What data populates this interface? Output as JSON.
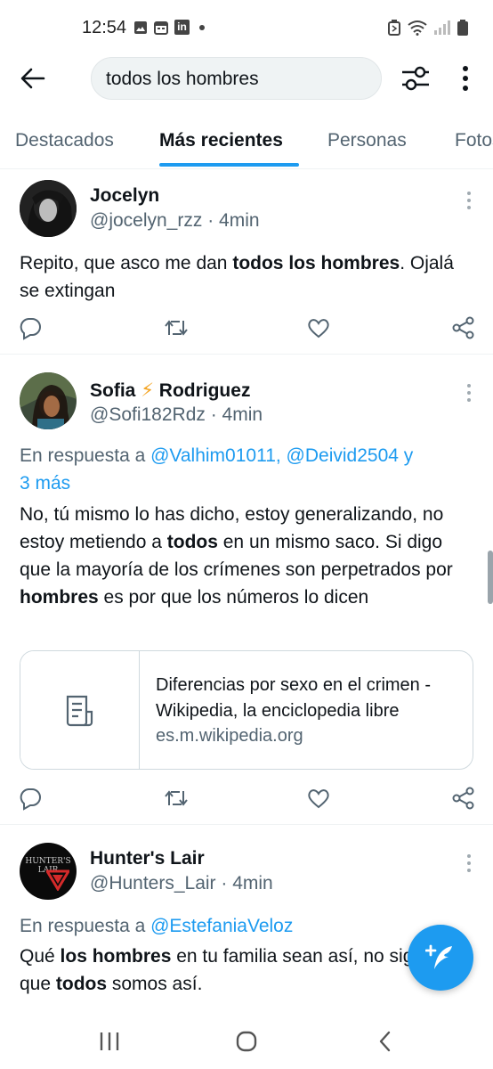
{
  "status_bar": {
    "time": "12:54",
    "left_icons": [
      "image-icon",
      "calendar-icon",
      "linkedin-icon",
      "dot-icon"
    ],
    "right_icons": [
      "battery-saver-icon",
      "wifi-icon",
      "signal-icon",
      "battery-icon"
    ],
    "linkedin_label": "in"
  },
  "topbar": {
    "search_query": "todos los hombres"
  },
  "tabs": [
    {
      "label": "Destacados",
      "active": false
    },
    {
      "label": "Más recientes",
      "active": true
    },
    {
      "label": "Personas",
      "active": false
    },
    {
      "label": "Fotos",
      "active": false
    }
  ],
  "tweets": [
    {
      "name": "Jocelyn",
      "name_suffix": "",
      "handle_time": "@jocelyn_rzz · 4min",
      "reply_prefix": "",
      "reply_mentions": "",
      "reply_tail": "",
      "reply_more": "",
      "body": [
        {
          "text": "Repito, que asco me dan "
        },
        {
          "text": "todos los hombres",
          "bold": true
        },
        {
          "text": ". Ojalá se extingan"
        }
      ]
    },
    {
      "name": "Sofia",
      "name_emoji": "⚡",
      "name_suffix": "Rodriguez",
      "handle_time": "@Sofi182Rdz · 4min",
      "reply_prefix": "En respuesta a ",
      "reply_mentions": "@Valhim01011, @Deivid2504",
      "reply_tail": " y",
      "reply_more": "3 más",
      "body": [
        {
          "text": "No, tú mismo lo has dicho, estoy generalizando, no estoy metiendo a "
        },
        {
          "text": "todos",
          "bold": true
        },
        {
          "text": " en un mismo saco. Si digo que la mayoría de los crímenes son perpetrados por "
        },
        {
          "text": "hombres",
          "bold": true
        },
        {
          "text": " es por que los números lo dicen"
        }
      ],
      "link_card": {
        "title": "Diferencias por sexo en el crimen - Wikipedia, la enciclopedia libre",
        "domain": "es.m.wikipedia.org"
      }
    },
    {
      "name": "Hunter's Lair",
      "handle_time": "@Hunters_Lair · 4min",
      "avatar_text_top": "HUNTER'S",
      "avatar_text_bottom": "LAIR",
      "reply_prefix": "En respuesta a ",
      "reply_mentions": "@EstefaniaVeloz",
      "body": [
        {
          "text": "Qué "
        },
        {
          "text": "los hombres",
          "bold": true
        },
        {
          "text": " en tu familia sean así, no significa que "
        },
        {
          "text": "todos",
          "bold": true
        },
        {
          "text": " somos así."
        }
      ]
    }
  ],
  "colors": {
    "accent": "#1d9bf0",
    "text_primary": "#0f1419",
    "text_secondary": "#536471"
  }
}
